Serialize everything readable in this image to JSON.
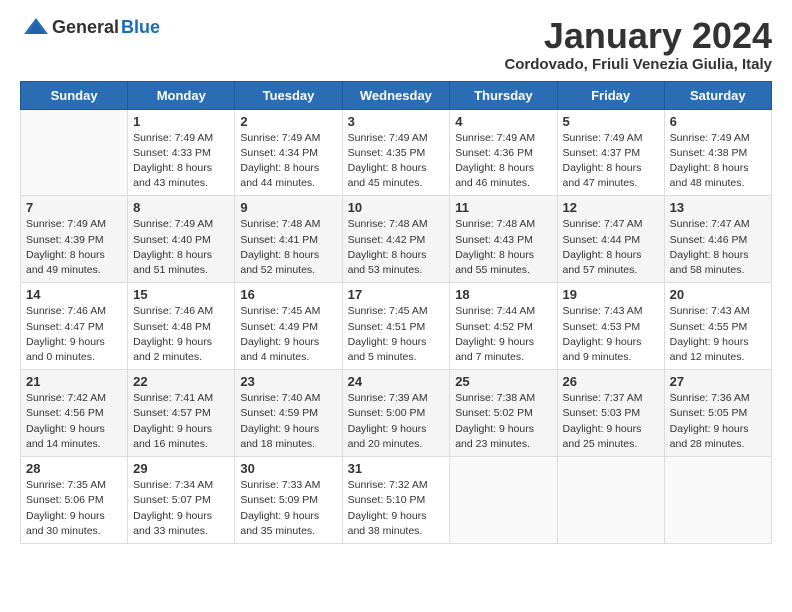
{
  "header": {
    "logo_general": "General",
    "logo_blue": "Blue",
    "title": "January 2024",
    "subtitle": "Cordovado, Friuli Venezia Giulia, Italy"
  },
  "days_of_week": [
    "Sunday",
    "Monday",
    "Tuesday",
    "Wednesday",
    "Thursday",
    "Friday",
    "Saturday"
  ],
  "weeks": [
    [
      {
        "day": "",
        "info": ""
      },
      {
        "day": "1",
        "info": "Sunrise: 7:49 AM\nSunset: 4:33 PM\nDaylight: 8 hours\nand 43 minutes."
      },
      {
        "day": "2",
        "info": "Sunrise: 7:49 AM\nSunset: 4:34 PM\nDaylight: 8 hours\nand 44 minutes."
      },
      {
        "day": "3",
        "info": "Sunrise: 7:49 AM\nSunset: 4:35 PM\nDaylight: 8 hours\nand 45 minutes."
      },
      {
        "day": "4",
        "info": "Sunrise: 7:49 AM\nSunset: 4:36 PM\nDaylight: 8 hours\nand 46 minutes."
      },
      {
        "day": "5",
        "info": "Sunrise: 7:49 AM\nSunset: 4:37 PM\nDaylight: 8 hours\nand 47 minutes."
      },
      {
        "day": "6",
        "info": "Sunrise: 7:49 AM\nSunset: 4:38 PM\nDaylight: 8 hours\nand 48 minutes."
      }
    ],
    [
      {
        "day": "7",
        "info": "Sunrise: 7:49 AM\nSunset: 4:39 PM\nDaylight: 8 hours\nand 49 minutes."
      },
      {
        "day": "8",
        "info": "Sunrise: 7:49 AM\nSunset: 4:40 PM\nDaylight: 8 hours\nand 51 minutes."
      },
      {
        "day": "9",
        "info": "Sunrise: 7:48 AM\nSunset: 4:41 PM\nDaylight: 8 hours\nand 52 minutes."
      },
      {
        "day": "10",
        "info": "Sunrise: 7:48 AM\nSunset: 4:42 PM\nDaylight: 8 hours\nand 53 minutes."
      },
      {
        "day": "11",
        "info": "Sunrise: 7:48 AM\nSunset: 4:43 PM\nDaylight: 8 hours\nand 55 minutes."
      },
      {
        "day": "12",
        "info": "Sunrise: 7:47 AM\nSunset: 4:44 PM\nDaylight: 8 hours\nand 57 minutes."
      },
      {
        "day": "13",
        "info": "Sunrise: 7:47 AM\nSunset: 4:46 PM\nDaylight: 8 hours\nand 58 minutes."
      }
    ],
    [
      {
        "day": "14",
        "info": "Sunrise: 7:46 AM\nSunset: 4:47 PM\nDaylight: 9 hours\nand 0 minutes."
      },
      {
        "day": "15",
        "info": "Sunrise: 7:46 AM\nSunset: 4:48 PM\nDaylight: 9 hours\nand 2 minutes."
      },
      {
        "day": "16",
        "info": "Sunrise: 7:45 AM\nSunset: 4:49 PM\nDaylight: 9 hours\nand 4 minutes."
      },
      {
        "day": "17",
        "info": "Sunrise: 7:45 AM\nSunset: 4:51 PM\nDaylight: 9 hours\nand 5 minutes."
      },
      {
        "day": "18",
        "info": "Sunrise: 7:44 AM\nSunset: 4:52 PM\nDaylight: 9 hours\nand 7 minutes."
      },
      {
        "day": "19",
        "info": "Sunrise: 7:43 AM\nSunset: 4:53 PM\nDaylight: 9 hours\nand 9 minutes."
      },
      {
        "day": "20",
        "info": "Sunrise: 7:43 AM\nSunset: 4:55 PM\nDaylight: 9 hours\nand 12 minutes."
      }
    ],
    [
      {
        "day": "21",
        "info": "Sunrise: 7:42 AM\nSunset: 4:56 PM\nDaylight: 9 hours\nand 14 minutes."
      },
      {
        "day": "22",
        "info": "Sunrise: 7:41 AM\nSunset: 4:57 PM\nDaylight: 9 hours\nand 16 minutes."
      },
      {
        "day": "23",
        "info": "Sunrise: 7:40 AM\nSunset: 4:59 PM\nDaylight: 9 hours\nand 18 minutes."
      },
      {
        "day": "24",
        "info": "Sunrise: 7:39 AM\nSunset: 5:00 PM\nDaylight: 9 hours\nand 20 minutes."
      },
      {
        "day": "25",
        "info": "Sunrise: 7:38 AM\nSunset: 5:02 PM\nDaylight: 9 hours\nand 23 minutes."
      },
      {
        "day": "26",
        "info": "Sunrise: 7:37 AM\nSunset: 5:03 PM\nDaylight: 9 hours\nand 25 minutes."
      },
      {
        "day": "27",
        "info": "Sunrise: 7:36 AM\nSunset: 5:05 PM\nDaylight: 9 hours\nand 28 minutes."
      }
    ],
    [
      {
        "day": "28",
        "info": "Sunrise: 7:35 AM\nSunset: 5:06 PM\nDaylight: 9 hours\nand 30 minutes."
      },
      {
        "day": "29",
        "info": "Sunrise: 7:34 AM\nSunset: 5:07 PM\nDaylight: 9 hours\nand 33 minutes."
      },
      {
        "day": "30",
        "info": "Sunrise: 7:33 AM\nSunset: 5:09 PM\nDaylight: 9 hours\nand 35 minutes."
      },
      {
        "day": "31",
        "info": "Sunrise: 7:32 AM\nSunset: 5:10 PM\nDaylight: 9 hours\nand 38 minutes."
      },
      {
        "day": "",
        "info": ""
      },
      {
        "day": "",
        "info": ""
      },
      {
        "day": "",
        "info": ""
      }
    ]
  ]
}
